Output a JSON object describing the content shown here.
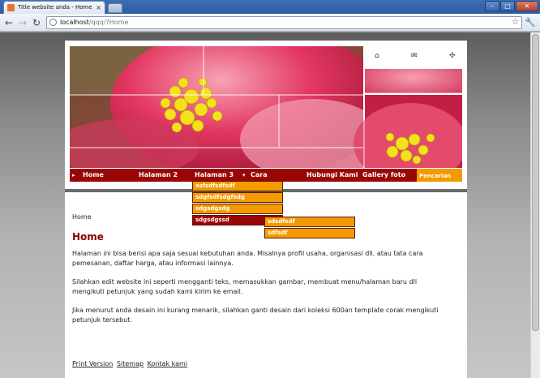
{
  "browser": {
    "tab_title": "Title website anda - Home",
    "url_host": "localhost",
    "url_path": "/qqq/?Home",
    "tab_close": "×"
  },
  "site": {
    "menu": [
      {
        "label": "Home"
      },
      {
        "label": "Halaman 2"
      },
      {
        "label": "Halaman 3"
      },
      {
        "label": "Cara"
      },
      {
        "label": "Hubungi Kami"
      },
      {
        "label": "Gallery foto"
      }
    ],
    "search_label": "Pencarian",
    "dropdown": [
      "asfsdfsdfsdf",
      "sdgfsdfsdgfsdg",
      "sdgsdgsdg",
      "sdgsdgssd"
    ],
    "subdropdown": [
      "sdsdfsdf",
      "sdfsdf"
    ]
  },
  "content": {
    "breadcrumb": "Home",
    "title": "Home",
    "paragraphs": [
      "Halaman ini bisa berisi apa saja sesuai kebutuhan anda. Misalnya profil usaha, organisasi dll, atau tata cara pemesanan, daftar harga, atau informasi lainnya.",
      "Silahkan edit website ini seperti mengganti teks, memasukkan gambar, membuat menu/halaman baru dll mengikuti petunjuk yang sudah kami kirim ke email.",
      "Jika menurut anda desain ini kurang menarik, silahkan ganti desain dari koleksi 600an template corak mengikuti petunjuk tersebut."
    ],
    "footer_links": [
      "Print Version",
      "Sitemap",
      "Kontak kami"
    ]
  },
  "colors": {
    "menu_bg": "#9a0606",
    "accent": "#f39a00",
    "heading": "#8b0000"
  }
}
